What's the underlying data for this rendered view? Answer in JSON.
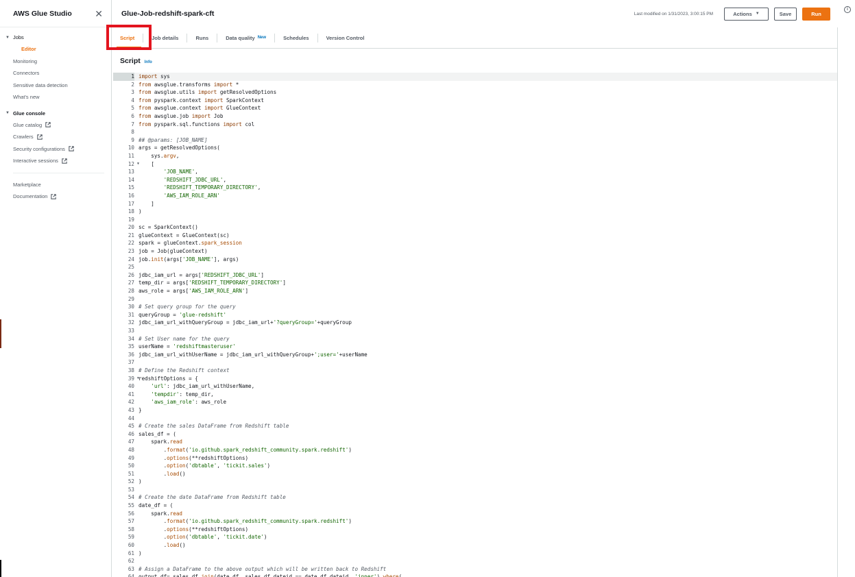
{
  "sidebar": {
    "title": "AWS Glue Studio",
    "jobs_label": "Jobs",
    "editor_label": "Editor",
    "items_top": [
      {
        "label": "Monitoring"
      },
      {
        "label": "Connectors"
      },
      {
        "label": "Sensitive data detection"
      },
      {
        "label": "What's new"
      }
    ],
    "glue_console_label": "Glue console",
    "console_items": [
      {
        "label": "Glue catalog"
      },
      {
        "label": "Crawlers"
      },
      {
        "label": "Security configurations"
      },
      {
        "label": "Interactive sessions"
      }
    ],
    "bottom_items": [
      {
        "label": "Marketplace"
      },
      {
        "label": "Documentation"
      }
    ]
  },
  "header": {
    "job_title": "Glue-Job-redshift-spark-cft",
    "last_modified": "Last modified on 1/31/2023, 3:00:15 PM",
    "actions_label": "Actions",
    "save_label": "Save",
    "run_label": "Run",
    "info_icon": "i"
  },
  "tabs": [
    {
      "label": "Script"
    },
    {
      "label": "Job details"
    },
    {
      "label": "Runs"
    },
    {
      "label": "Data quality",
      "badge": "New"
    },
    {
      "label": "Schedules"
    },
    {
      "label": "Version Control"
    }
  ],
  "script": {
    "title": "Script",
    "info": "Info"
  },
  "colors": {
    "accent": "#ec7211",
    "link": "#0073bb",
    "highlight": "#e3141e"
  },
  "code_lines": [
    "import sys",
    "from awsglue.transforms import *",
    "from awsglue.utils import getResolvedOptions",
    "from pyspark.context import SparkContext",
    "from awsglue.context import GlueContext",
    "from awsglue.job import Job",
    "from pyspark.sql.functions import col",
    "",
    "## @params: [JOB_NAME]",
    "args = getResolvedOptions(",
    "    sys.argv,",
    "    [",
    "        'JOB_NAME',",
    "        'REDSHIFT_JDBC_URL',",
    "        'REDSHIFT_TEMPORARY_DIRECTORY',",
    "        'AWS_IAM_ROLE_ARN'",
    "    ]",
    ")",
    "",
    "sc = SparkContext()",
    "glueContext = GlueContext(sc)",
    "spark = glueContext.spark_session",
    "job = Job(glueContext)",
    "job.init(args['JOB_NAME'], args)",
    "",
    "jdbc_iam_url = args['REDSHIFT_JDBC_URL']",
    "temp_dir = args['REDSHIFT_TEMPORARY_DIRECTORY']",
    "aws_role = args['AWS_IAM_ROLE_ARN']",
    "",
    "# Set query group for the query",
    "queryGroup = 'glue-redshift'",
    "jdbc_iam_url_withQueryGroup = jdbc_iam_url+'?queryGroup='+queryGroup",
    "",
    "# Set User name for the query",
    "userName = 'redshiftmasteruser'",
    "jdbc_iam_url_withUserName = jdbc_iam_url_withQueryGroup+';user='+userName",
    "",
    "# Define the Redshift context",
    "redshiftOptions = {",
    "    'url': jdbc_iam_url_withUserName,",
    "    'tempdir': temp_dir,",
    "    'aws_iam_role': aws_role",
    "}",
    "",
    "# Create the sales DataFrame from Redshift table",
    "sales_df = (",
    "    spark.read",
    "        .format('io.github.spark_redshift_community.spark.redshift')",
    "        .options(**redshiftOptions)",
    "        .option('dbtable', 'tickit.sales')",
    "        .load()",
    ")",
    "",
    "# Create the date DataFrame from Redshift table",
    "date_df = (",
    "    spark.read",
    "        .format('io.github.spark_redshift_community.spark.redshift')",
    "        .options(**redshiftOptions)",
    "        .option('dbtable', 'tickit.date')",
    "        .load()",
    ")",
    "",
    "# Assign a DataFrame to the above output which will be written back to Redshift",
    "output_df= sales_df.join(date_df, sales_df.dateid == date_df.dateid, 'inner').where("
  ]
}
